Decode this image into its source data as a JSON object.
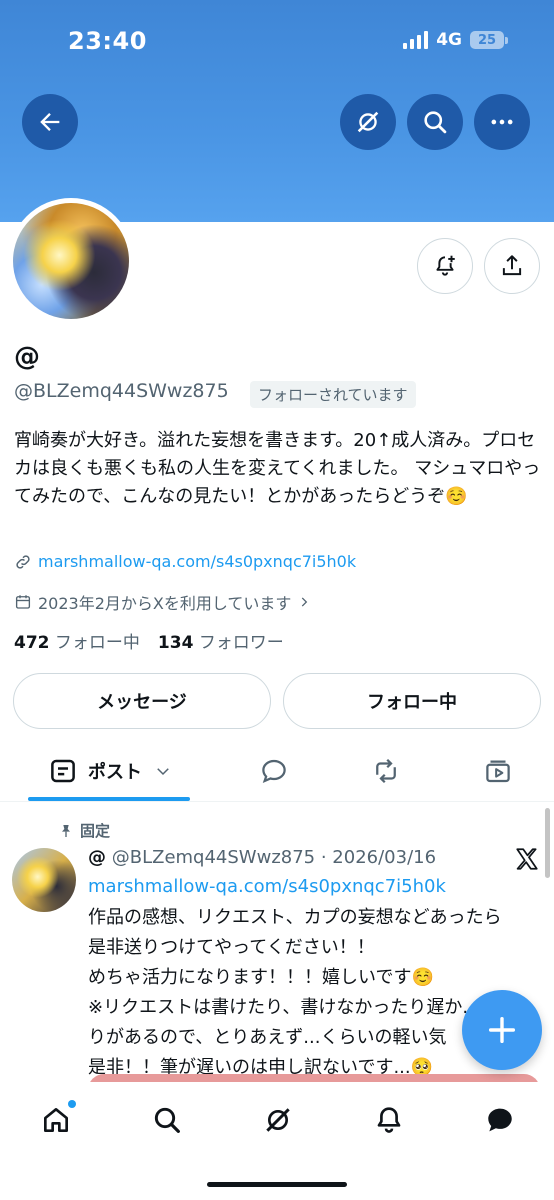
{
  "status_bar": {
    "time": "23:40",
    "network": "4G",
    "battery": "25"
  },
  "icons": {
    "back": "arrow-left-icon",
    "grok": "grok-icon",
    "search": "search-icon",
    "more": "more-icon",
    "notify": "bell-plus-icon",
    "share": "share-icon",
    "link": "link-icon",
    "calendar": "calendar-icon",
    "pin": "pin-icon"
  },
  "profile": {
    "name": "@",
    "handle": "@BLZemq44SWwz875",
    "follows_you": "フォローされています",
    "bio": "宵崎奏が大好き。溢れた妄想を書きます。20↑成人済み。プロセカは良くも悪くも私の人生を変えてくれました。 マシュマロやってみたので、こんなの見たい！とかがあったらどうぞ☺️",
    "link": "marshmallow-qa.com/s4s0pxnqc7i5h0k",
    "joined": "2023年2月からXを利用しています",
    "following_count": "472",
    "following_label": "フォロー中",
    "followers_count": "134",
    "followers_label": "フォロワー"
  },
  "actions": {
    "message": "メッセージ",
    "following": "フォロー中"
  },
  "tabs": {
    "posts": "ポスト"
  },
  "pinned_post": {
    "pinned_label": "固定",
    "name": "@",
    "handle_date": "@BLZemq44SWwz875 · 2026/03/16",
    "link": "marshmallow-qa.com/s4s0pxnqc7i5h0k",
    "lines": [
      "作品の感想、リクエスト、カプの妄想などあったら是非送りつけてやってください！！",
      "めちゃ活力になります！！！嬉しいです☺️",
      "※リクエストは書けたり、書けなかったり遅か...たりがあるので、とりあえず...くらいの軽い気",
      "是非！！筆が遅いのは申し訳ないです...🥺"
    ]
  },
  "colors": {
    "accent": "#1d9bf0",
    "banner": "#4a95e4",
    "media": "#e79a9a"
  }
}
